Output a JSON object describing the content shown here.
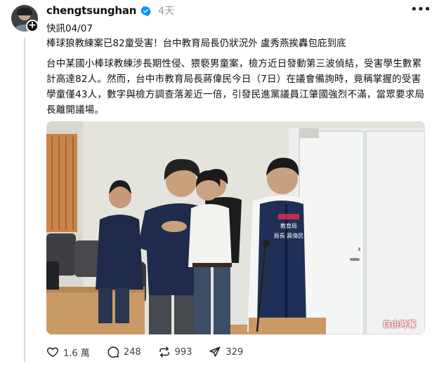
{
  "post": {
    "username": "chengtsunghan",
    "time": "4天",
    "text_line1": "快訊04/07",
    "text_line2": "棒球狼教練案已82童受害！台中教育局長仍狀況外 盧秀燕挨轟包庇到底",
    "body": "台中某國小棒球教練涉長期性侵、猥褻男童案，檢方近日發動第三波偵結，受害學生數累計高達82人。然而，台中市教育局長蔣偉民今日（7日）在議會備詢時，竟稱掌握的受害學童僅43人，數字與檢方調查落差近一倍，引發民進黨議員江肇國強烈不滿，當眾要求局長離開議場。"
  },
  "photo": {
    "vest_label_line1": "教育局",
    "vest_label_line2": "局長 蔣偉民",
    "watermark": "自由時報"
  },
  "actions": {
    "likes": "1.6 萬",
    "comments": "248",
    "reposts": "993",
    "shares": "329"
  },
  "icons": {
    "like": "heart-icon",
    "comment": "comment-bubble-icon",
    "repost": "repost-icon",
    "share": "send-icon",
    "more": "more-horizontal-icon",
    "verified": "verified-badge-icon",
    "follow": "plus-icon"
  },
  "colors": {
    "verified": "#0095f6",
    "text": "#101010",
    "secondary": "#999999"
  }
}
